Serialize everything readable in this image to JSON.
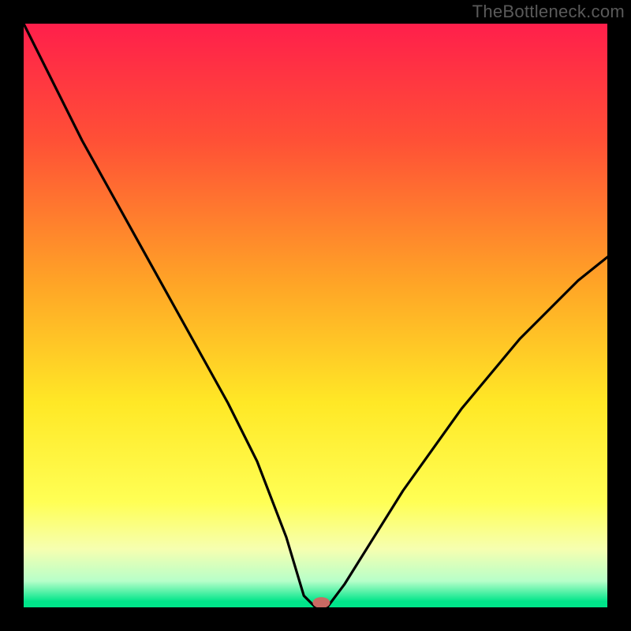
{
  "watermark": "TheBottleneck.com",
  "chart_data": {
    "type": "line",
    "title": "",
    "xlabel": "",
    "ylabel": "",
    "xlim": [
      0,
      100
    ],
    "ylim": [
      0,
      100
    ],
    "x": [
      0,
      5,
      10,
      15,
      20,
      25,
      30,
      35,
      40,
      45,
      48,
      50,
      52,
      55,
      60,
      65,
      70,
      75,
      80,
      85,
      90,
      95,
      100
    ],
    "y": [
      100,
      90,
      80,
      71,
      62,
      53,
      44,
      35,
      25,
      12,
      2,
      0,
      0,
      4,
      12,
      20,
      27,
      34,
      40,
      46,
      51,
      56,
      60
    ],
    "marker": {
      "x": 51,
      "y": 0.8,
      "color": "#c96a63"
    },
    "gradient_stops": [
      {
        "offset": 0.0,
        "color": "#ff1f4b"
      },
      {
        "offset": 0.2,
        "color": "#ff5036"
      },
      {
        "offset": 0.45,
        "color": "#ffa626"
      },
      {
        "offset": 0.65,
        "color": "#ffe826"
      },
      {
        "offset": 0.82,
        "color": "#ffff55"
      },
      {
        "offset": 0.9,
        "color": "#f6ffb0"
      },
      {
        "offset": 0.955,
        "color": "#b7ffc9"
      },
      {
        "offset": 0.99,
        "color": "#00e58a"
      },
      {
        "offset": 1.0,
        "color": "#00e58a"
      }
    ]
  }
}
